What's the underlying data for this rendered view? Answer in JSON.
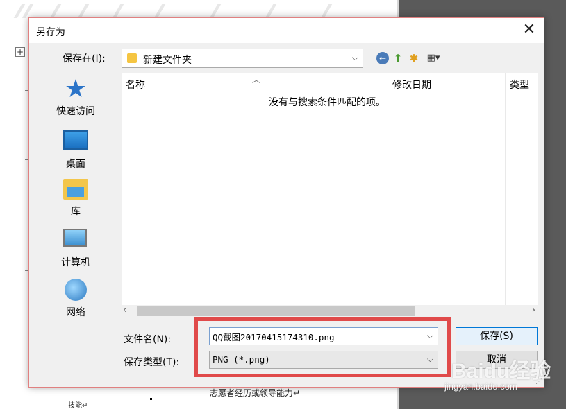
{
  "dialog": {
    "title": "另存为",
    "close_label": "✕"
  },
  "savein": {
    "label": "保存在(I):",
    "value": "新建文件夹"
  },
  "places": [
    {
      "label": "快速访问"
    },
    {
      "label": "桌面"
    },
    {
      "label": "库"
    },
    {
      "label": "计算机"
    },
    {
      "label": "网络"
    }
  ],
  "filelist": {
    "columns": [
      "名称",
      "修改日期",
      "类型"
    ],
    "empty_message": "没有与搜索条件匹配的项。"
  },
  "filename": {
    "label": "文件名(N):",
    "value": "QQ截图20170415174310.png"
  },
  "filetype": {
    "label": "保存类型(T):",
    "value": "PNG (*.png)"
  },
  "buttons": {
    "save": "保存(S)",
    "cancel": "取消"
  },
  "background": {
    "bottom_text": "志愿者经历或领导能力↵",
    "left_text": "技能↵"
  },
  "watermark": {
    "brand": "Baidu经验",
    "url": "jingyan.baidu.com"
  },
  "colors": {
    "highlight": "#e04a4a",
    "accent": "#0078d7"
  }
}
